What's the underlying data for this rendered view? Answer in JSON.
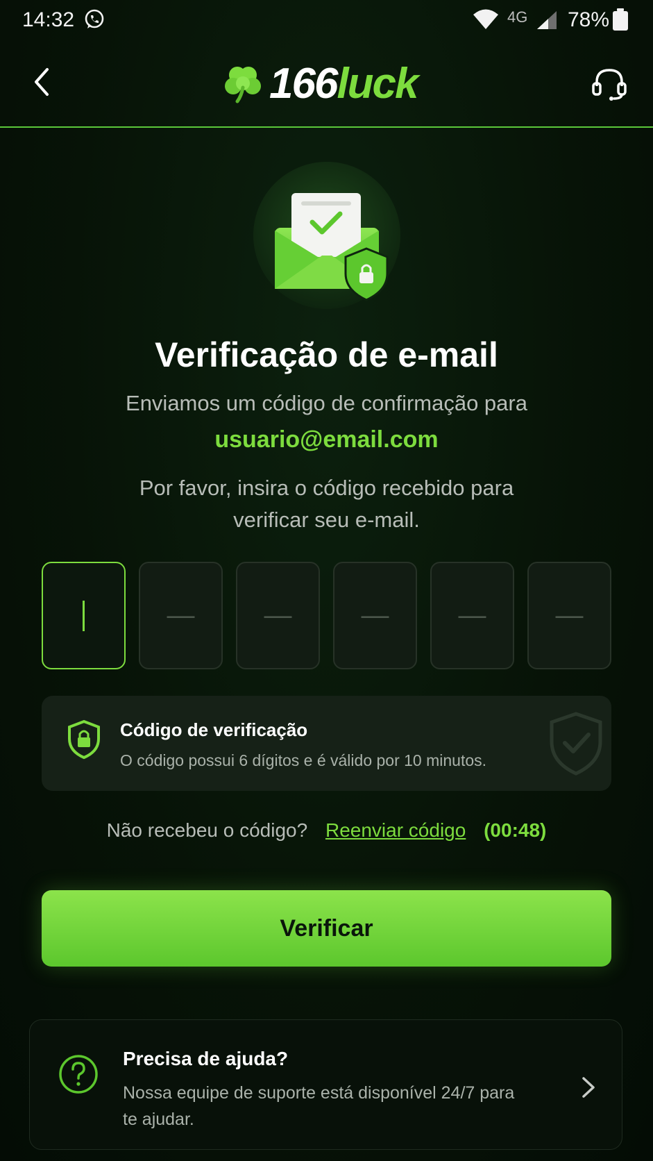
{
  "status_bar": {
    "time": "14:32",
    "network": "4G",
    "battery": "78%"
  },
  "header": {
    "logo_number": "166",
    "logo_word": "luck"
  },
  "title": "Verificação de e-mail",
  "subtitle": "Enviamos um código de confirmação para",
  "email": "usuario@email.com",
  "instructions": "Por favor, insira o código recebido para verificar seu e-mail.",
  "code_inputs": {
    "count": 6,
    "placeholder": "—",
    "active_index": 0
  },
  "info_card": {
    "title": "Código de verificação",
    "text": "O código possui 6 dígitos e é válido por 10 minutos."
  },
  "resend": {
    "label": "Não recebeu o código?",
    "link": "Reenviar código",
    "timer": "(00:48)"
  },
  "verify_button": "Verificar",
  "help": {
    "title": "Precisa de ajuda?",
    "text": "Nossa equipe de suporte está disponível 24/7 para te ajudar."
  },
  "colors": {
    "accent": "#7ddc3e",
    "background": "#061106",
    "card": "#162117"
  },
  "icons": [
    "whatsapp-icon",
    "wifi-icon",
    "signal-icon",
    "battery-icon",
    "back-icon",
    "clover-logo-icon",
    "headset-icon",
    "email-shield-icon",
    "shield-lock-icon",
    "shield-check-icon",
    "question-icon",
    "chevron-right-icon"
  ]
}
